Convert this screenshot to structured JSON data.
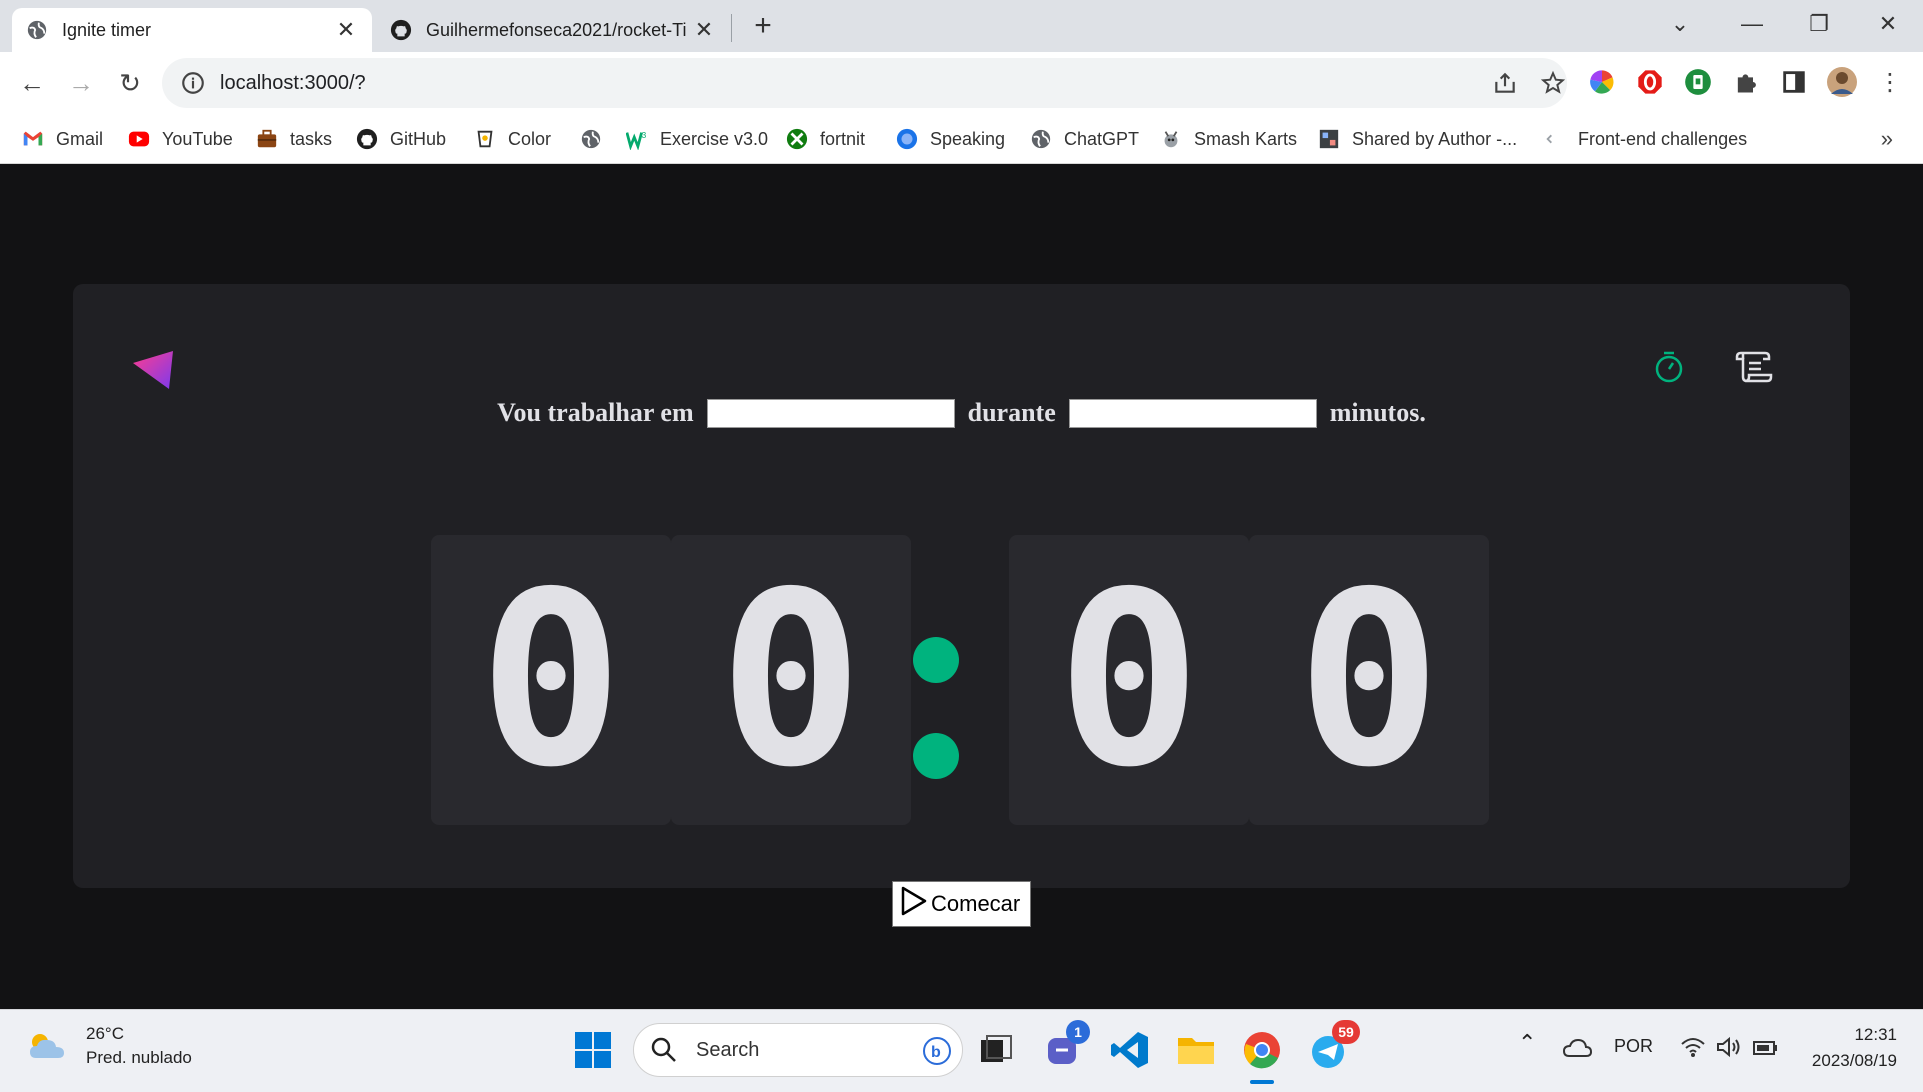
{
  "browser": {
    "tabs": [
      {
        "title": "Ignite timer",
        "active": true
      },
      {
        "title": "Guilhermefonseca2021/rocket-Ti",
        "active": false
      }
    ],
    "url": "localhost:3000/?",
    "bookmarks": [
      {
        "label": "Gmail",
        "icon": "gmail-icon"
      },
      {
        "label": "YouTube",
        "icon": "youtube-icon"
      },
      {
        "label": "tasks",
        "icon": "briefcase-icon"
      },
      {
        "label": "GitHub",
        "icon": "github-icon"
      },
      {
        "label": "Color",
        "icon": "color-icon"
      },
      {
        "label": "",
        "icon": "globe-icon"
      },
      {
        "label": "Exercise v3.0",
        "icon": "w3-icon"
      },
      {
        "label": "fortnit",
        "icon": "xbox-icon"
      },
      {
        "label": "Speaking",
        "icon": "speaking-icon"
      },
      {
        "label": "ChatGPT",
        "icon": "globe-icon"
      },
      {
        "label": "Smash Karts",
        "icon": "smash-karts-icon"
      },
      {
        "label": "Shared by Author -...",
        "icon": "shared-icon"
      },
      {
        "label": "Front-end challenges",
        "icon": "frontend-icon"
      }
    ]
  },
  "app": {
    "form": {
      "task_label": "Vou trabalhar em",
      "task_value": "",
      "duration_label": "durante",
      "duration_value": "",
      "minutes_label": "minutos."
    },
    "countdown": {
      "minutes_tens": "0",
      "minutes_ones": "0",
      "seconds_tens": "0",
      "seconds_ones": "0"
    },
    "start_button_label": "Comecar",
    "colors": {
      "accent": "#00b37e",
      "card_bg": "#202024",
      "page_bg": "#121214",
      "digit_bg": "#29292e"
    }
  },
  "taskbar": {
    "weather_temp": "26°C",
    "weather_desc": "Pred. nublado",
    "search_placeholder": "Search",
    "teams_badge": "1",
    "telegram_badge": "59",
    "language": "POR",
    "time": "12:31",
    "date": "2023/08/19"
  }
}
